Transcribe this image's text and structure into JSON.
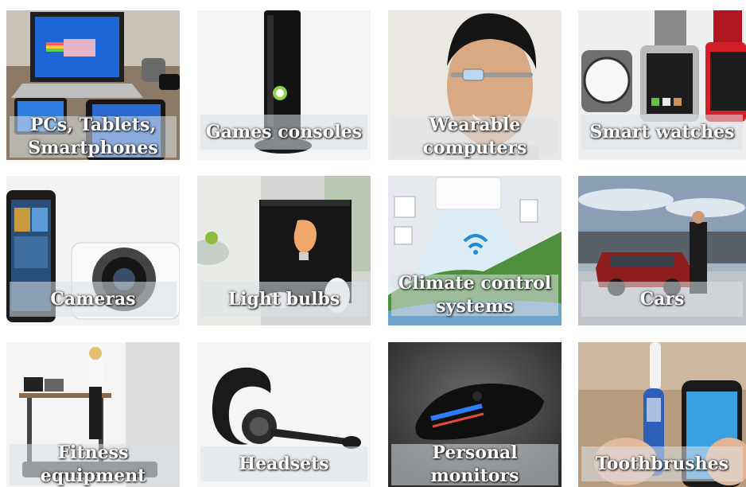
{
  "tiles": [
    {
      "label": "PCs, Tablets, Smartphones",
      "bg": "#8a7a66"
    },
    {
      "label": "Games consoles",
      "bg": "#f4f4f4"
    },
    {
      "label": "Wearable computers",
      "bg": "#e9e6e2"
    },
    {
      "label": "Smart watches",
      "bg": "#eeeeee"
    },
    {
      "label": "Cameras",
      "bg": "#f2f2f2"
    },
    {
      "label": "Light bulbs",
      "bg": "#cfd3cf"
    },
    {
      "label": "Climate control systems",
      "bg": "#e8ecef"
    },
    {
      "label": "Cars",
      "bg": "#9aa7b4"
    },
    {
      "label": "Fitness equipment",
      "bg": "#f3f3f3"
    },
    {
      "label": "Headsets",
      "bg": "#f5f5f5"
    },
    {
      "label": "Personal monitors",
      "bg": "#3a3a3a"
    },
    {
      "label": "Toothbrushes",
      "bg": "#b69b7d"
    }
  ]
}
